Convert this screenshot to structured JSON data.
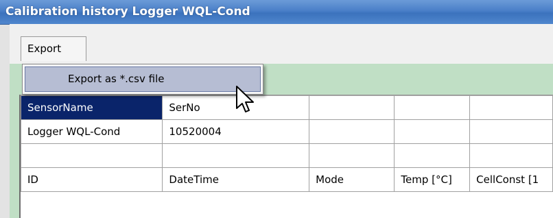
{
  "window": {
    "title": "Calibration history Logger WQL-Cond"
  },
  "menu": {
    "export_label": "Export",
    "export_menu_item": "Export as *.csv file"
  },
  "table": {
    "rows": [
      [
        "SensorName",
        "SerNo",
        "",
        "",
        ""
      ],
      [
        "Logger WQL-Cond",
        "10520004",
        "",
        "",
        ""
      ],
      [
        "",
        "",
        "",
        "",
        ""
      ],
      [
        "ID",
        "DateTime",
        "Mode",
        "Temp [°C]",
        "CellConst [1"
      ]
    ],
    "selected_cell": "SensorName"
  },
  "colors": {
    "title_bar": "#4a7fc8",
    "grid_background": "#c0dfc5",
    "selected_cell": "#0a246a",
    "menu_highlight": "#b6bdd3"
  },
  "icons": {
    "cursor": "mouse-pointer-icon"
  }
}
